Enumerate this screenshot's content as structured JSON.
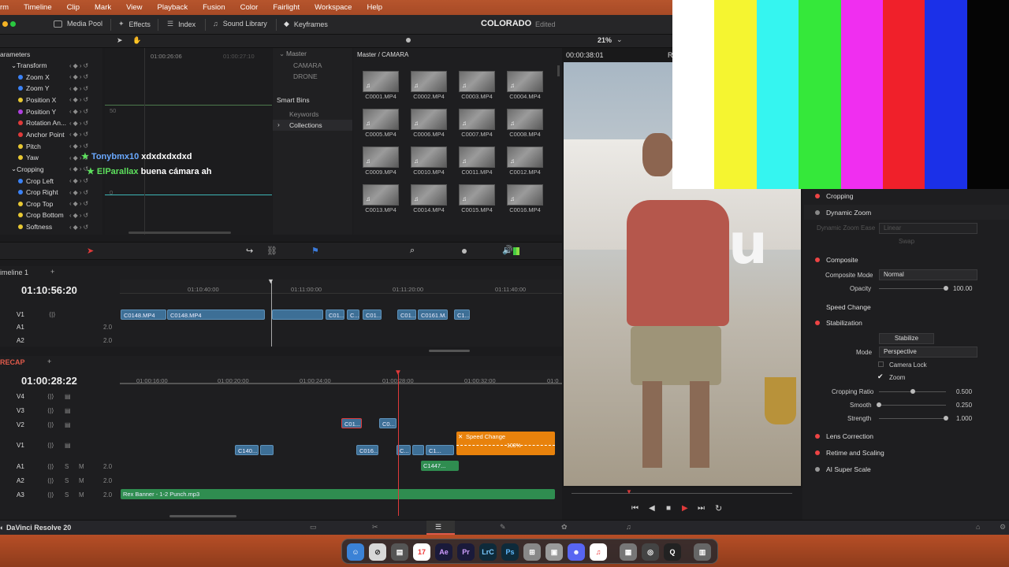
{
  "menu": [
    "rm",
    "Timeline",
    "Clip",
    "Mark",
    "View",
    "Playback",
    "Fusion",
    "Color",
    "Fairlight",
    "Workspace",
    "Help"
  ],
  "toolbar": {
    "media_pool": "Media Pool",
    "effects": "Effects",
    "index": "Index",
    "sound_library": "Sound Library",
    "keyframes": "Keyframes",
    "project": "COLORADO",
    "edited": "Edited",
    "zoom": "21%",
    "timecode": "00:00:38:01",
    "r_label": "R"
  },
  "params": {
    "title": "arameters",
    "ruler_a": "01:00:26:06",
    "ruler_b": "01:00:27:10",
    "val_50": "50",
    "val_0": "0",
    "items": [
      "Transform",
      "Zoom X",
      "Zoom Y",
      "Position X",
      "Position Y",
      "Rotation An...",
      "Anchor Point",
      "Pitch",
      "Yaw",
      "Cropping",
      "Crop Left",
      "Crop Right",
      "Crop Top",
      "Crop Bottom",
      "Softness"
    ]
  },
  "bins": {
    "master": "Master",
    "camara": "CAMARA",
    "drone": "DRONE",
    "smart_bins": "Smart Bins",
    "keywords": "Keywords",
    "collections": "Collections",
    "path": "Master / CAMARA"
  },
  "clips": [
    "C0001.MP4",
    "C0002.MP4",
    "C0003.MP4",
    "C0004.MP4",
    "C0005.MP4",
    "C0006.MP4",
    "C0007.MP4",
    "C0008.MP4",
    "C0009.MP4",
    "C0010.MP4",
    "C0011.MP4",
    "C0012.MP4",
    "C0013.MP4",
    "C0014.MP4",
    "C0015.MP4",
    "C0016.MP4"
  ],
  "chat": [
    {
      "user": "Tonybmx10",
      "msg": "xdxdxdxdxd",
      "color": "#6aa9ff"
    },
    {
      "user": "ElParallax",
      "msg": "buena cámara ah",
      "color": "#5de05d"
    }
  ],
  "timeline1": {
    "name": "imeline 1",
    "tc": "01:10:56:20",
    "ruler": [
      "01:10:40:00",
      "01:11:00:00",
      "01:11:20:00",
      "01:11:40:00"
    ],
    "tracks": [
      "V1",
      "A1",
      "A2"
    ],
    "vol": "2.0",
    "clips": [
      "C0148.MP4",
      "C0148.MP4",
      "C01...",
      "C...",
      "C01...",
      "C01...",
      "C0161.M...",
      "C1..."
    ]
  },
  "timeline2": {
    "name": "RECAP",
    "tc": "01:00:28:22",
    "ruler": [
      "01:00:16:00",
      "01:00:20:00",
      "01:00:24:00",
      "01:00:28:00",
      "01:00:32:00",
      "01:0"
    ],
    "tracks": [
      "V4",
      "V3",
      "V2",
      "V1",
      "A1",
      "A2",
      "A3"
    ],
    "vol": "2.0",
    "clips": [
      "C01...",
      "C0...",
      "C140...",
      "C016...",
      "C...",
      "C1...",
      "C1447..."
    ],
    "speed_change": "Speed Change",
    "speed_pct": "100%",
    "audio_clip": "Rex Banner - 1-2 Punch.mp3",
    "s": "S",
    "m": "M"
  },
  "inspector": {
    "cropping": "Cropping",
    "dynamic_zoom": "Dynamic Zoom",
    "dz_ease": "Dynamic Zoom Ease",
    "linear": "Linear",
    "swap": "Swap",
    "composite": "Composite",
    "composite_mode": "Composite Mode",
    "normal": "Normal",
    "opacity": "Opacity",
    "opacity_val": "100.00",
    "speed_change": "Speed Change",
    "stabilization": "Stabilization",
    "stabilize": "Stabilize",
    "mode": "Mode",
    "perspective": "Perspective",
    "camera_lock": "Camera Lock",
    "zoom": "Zoom",
    "cropping_ratio": "Cropping Ratio",
    "cropping_ratio_val": "0.500",
    "smooth": "Smooth",
    "smooth_val": "0.250",
    "strength": "Strength",
    "strength_val": "1.000",
    "lens_correction": "Lens Correction",
    "retime": "Retime and Scaling",
    "ai_super": "AI Super Scale",
    "opacity_level": 1,
    "cropping_ratio_level": 0.5,
    "smooth_level": 0.25,
    "strength_level": 1
  },
  "bottom": {
    "app": "DaVinci Resolve 20"
  },
  "dock": [
    "17",
    "Ae",
    "Pr",
    "LrC",
    "Ps"
  ],
  "colors": {
    "menubar": "#b6552d",
    "clip_blue": "#3d6f96",
    "clip_green": "#2f8d50",
    "speed_orange": "#e8820c",
    "playhead": "#e03a3a"
  }
}
